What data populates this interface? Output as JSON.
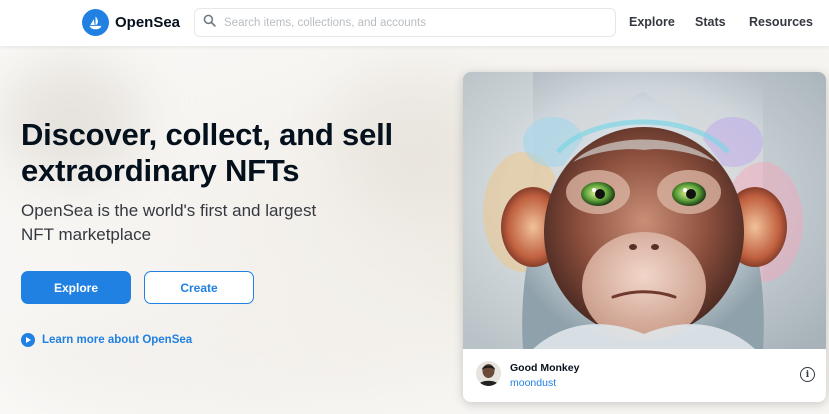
{
  "nav": {
    "logo_text": "OpenSea",
    "search_placeholder": "Search items, collections, and accounts",
    "links": [
      "Explore",
      "Stats",
      "Resources"
    ]
  },
  "hero": {
    "title": "Discover, collect, and sell extraordinary NFTs",
    "subtitle": "OpenSea is the world's first and largest NFT marketplace",
    "explore_label": "Explore",
    "create_label": "Create",
    "learn_more_label": "Learn more about OpenSea"
  },
  "featured": {
    "item_name": "Good Monkey",
    "creator": "moondust",
    "info_glyph": "i"
  },
  "colors": {
    "accent": "#2081e2",
    "text_dark": "#04111d",
    "text_muted": "#353840"
  },
  "icons": [
    "opensea-logo-icon",
    "search-icon",
    "play-circle-icon",
    "info-icon",
    "monkey-artwork",
    "creator-avatar"
  ]
}
